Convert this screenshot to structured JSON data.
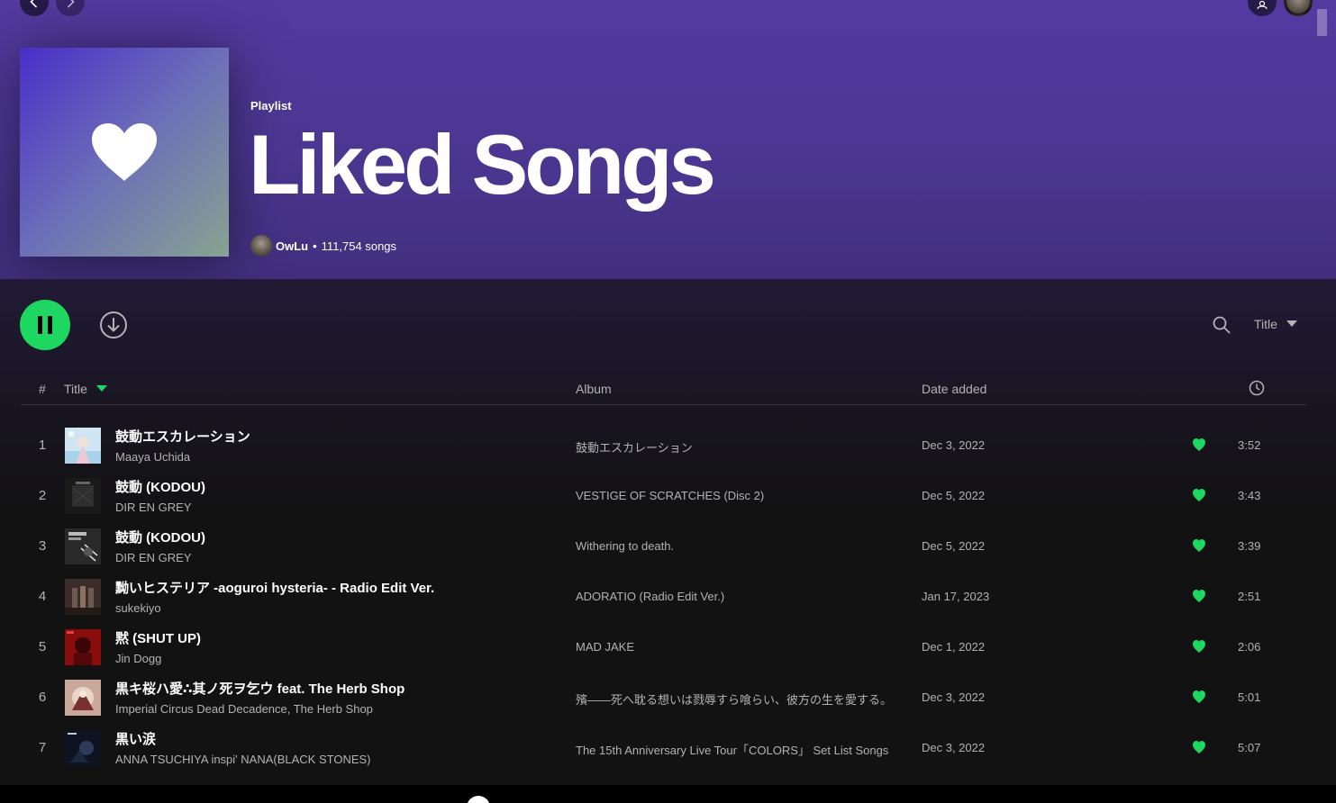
{
  "header": {
    "type_label": "Playlist",
    "title": "Liked Songs",
    "owner": "OwLu",
    "separator": "•",
    "song_count": "111,754 songs"
  },
  "controls": {
    "sort_label": "Title"
  },
  "table": {
    "col_num": "#",
    "col_title": "Title",
    "col_album": "Album",
    "col_date": "Date added"
  },
  "tracks": [
    {
      "num": "1",
      "title": "鼓動エスカレーション",
      "artist": "Maaya Uchida",
      "album": "鼓動エスカレーション",
      "date": "Dec 3, 2022",
      "duration": "3:52"
    },
    {
      "num": "2",
      "title": "鼓動 (KODOU)",
      "artist": "DIR EN GREY",
      "album": "VESTIGE OF SCRATCHES (Disc 2)",
      "date": "Dec 5, 2022",
      "duration": "3:43"
    },
    {
      "num": "3",
      "title": "鼓動 (KODOU)",
      "artist": "DIR EN GREY",
      "album": "Withering to death.",
      "date": "Dec 5, 2022",
      "duration": "3:39"
    },
    {
      "num": "4",
      "title": "黝いヒステリア -aoguroi hysteria- - Radio Edit Ver.",
      "artist": "sukekiyo",
      "album": "ADORATIO (Radio Edit Ver.)",
      "date": "Jan 17, 2023",
      "duration": "2:51"
    },
    {
      "num": "5",
      "title": "黙 (SHUT UP)",
      "artist": "Jin Dogg",
      "album": "MAD JAKE",
      "date": "Dec 1, 2022",
      "duration": "2:06"
    },
    {
      "num": "6",
      "title": "黒キ桜ハ愛∴其ノ死ヲ乞ウ feat. The Herb Shop",
      "artist": "Imperial Circus Dead Decadence, The Herb Shop",
      "album": "殯——死へ耽る想いは戮辱すら喰らい、彼方の生を愛する。",
      "date": "Dec 3, 2022",
      "duration": "5:01"
    },
    {
      "num": "7",
      "title": "黒い涙",
      "artist": "ANNA TSUCHIYA inspi' NANA(BLACK STONES)",
      "album": "The 15th Anniversary Live Tour「COLORS」 Set List Songs",
      "date": "Dec 3, 2022",
      "duration": "5:07"
    }
  ],
  "colors": {
    "accent": "#1ed760",
    "hero_top": "#533aa0",
    "background": "#121212"
  }
}
